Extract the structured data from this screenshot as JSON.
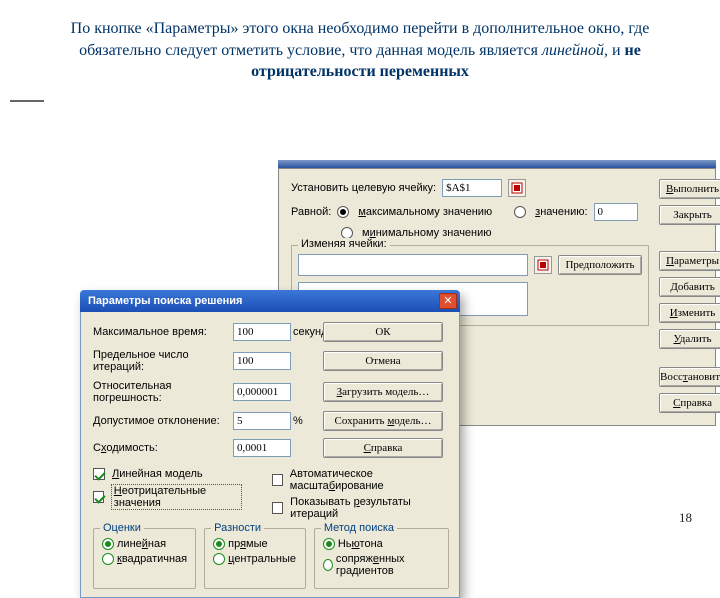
{
  "slide": {
    "title_html": "По кнопке «Параметры» этого окна необходимо перейти в дополнительное окно, где обязательно следует отметить условие, что данная модель является <i>линейной,</i> и <b>не отрицательности переменных</b>",
    "page_number": "18"
  },
  "solver": {
    "target_label": "Установить целевую ячейку:",
    "target_value": "$A$1",
    "equal_label": "Равной:",
    "opt_max": "максимальному значению",
    "opt_val": "значению:",
    "opt_min": "минимальному значению",
    "value_value": "0",
    "changing_label": "Изменяя ячейки:",
    "guess": "Предположить",
    "buttons": {
      "run": "Выполнить",
      "close": "Закрыть",
      "params": "Параметры",
      "add": "Добавить",
      "edit": "Изменить",
      "delete": "Удалить",
      "restore": "Восстановить",
      "help": "Справка"
    }
  },
  "params": {
    "title": "Параметры поиска решения",
    "rows": {
      "max_time": "Максимальное время:",
      "max_time_val": "100",
      "seconds": "секунд",
      "iterations": "Предельное число итераций:",
      "iterations_val": "100",
      "precision": "Относительная погрешность:",
      "precision_val": "0,000001",
      "tolerance": "Допустимое отклонение:",
      "tolerance_val": "5",
      "percent": "%",
      "convergence": "Сходимость:",
      "convergence_val": "0,0001"
    },
    "buttons": {
      "ok": "ОК",
      "cancel": "Отмена",
      "load": "Загрузить модель…",
      "save": "Сохранить модель…",
      "help": "Справка"
    },
    "checks": {
      "linear": "Линейная модель",
      "nonneg": "Неотрицательные значения",
      "autoscale": "Автоматическое масштабирование",
      "showiter": "Показывать результаты итераций"
    },
    "groups": {
      "estimates": "Оценки",
      "est_linear": "линейная",
      "est_quad": "квадратичная",
      "deriv": "Разности",
      "deriv_fwd": "прямые",
      "deriv_cent": "центральные",
      "search": "Метод поиска",
      "newton": "Ньютона",
      "conjgrad": "сопряженных градиентов"
    }
  }
}
